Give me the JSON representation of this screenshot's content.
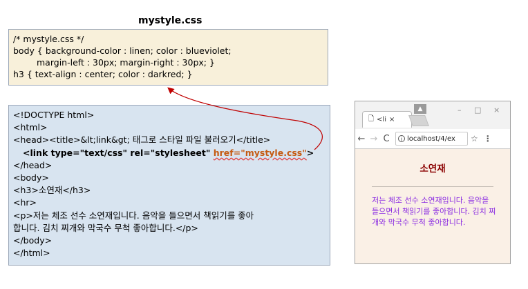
{
  "css_file": {
    "title": "mystyle.css",
    "lines": [
      "/* mystyle.css */",
      "body { background-color : linen; color : blueviolet;",
      "margin-left : 30px; margin-right : 30px; }",
      "h3 { text-align : center; color : darkred; }"
    ]
  },
  "html_file": {
    "lines": [
      "<!DOCTYPE html>",
      "<html>",
      "<head><title>&lt;link&gt; 태그로 스타일 파일 불러오기</title>",
      "</head>",
      "<body>",
      "<h3>소연재</h3>",
      "<hr>",
      "<p>저는 체조 선수 소연재입니다. 음악을 들으면서 책읽기를 좋아",
      "합니다. 김치 찌개와 막국수 무척 좋아합니다.</p>",
      "</body>",
      "</html>"
    ],
    "link_line": {
      "start": "<link type=\"text/css\" rel=\"stylesheet\" ",
      "href": "href=\"mystyle.css\"",
      "end": ">"
    }
  },
  "browser": {
    "tab_label": "<li",
    "tab_close": "×",
    "address": "localhost/4/ex",
    "window_controls": {
      "minimize": "–",
      "maximize": "□",
      "close": "×"
    },
    "page": {
      "heading": "소연재",
      "paragraph": "저는 체조 선수 소연재입니다. 음악을 들으면서 책읽기를 좋아합니다. 김치 찌개와 막국수 무척 좋아합니다."
    }
  },
  "colors": {
    "css_box_bg": "#f8f0da",
    "html_box_bg": "#d8e4f0",
    "heading": "#8b0000",
    "paragraph": "#8a2be2",
    "page_bg": "#faf0e6",
    "href_color": "#c55a11",
    "arrow": "#c00000"
  }
}
